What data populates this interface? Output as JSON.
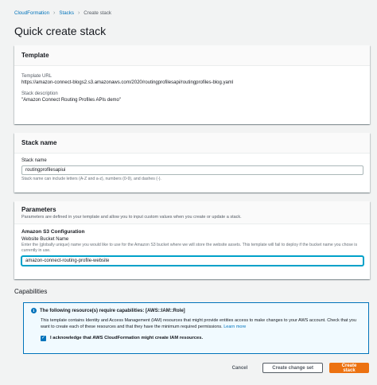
{
  "breadcrumb": {
    "items": [
      "CloudFormation",
      "Stacks",
      "Create stack"
    ]
  },
  "page_title": "Quick create stack",
  "template_panel": {
    "title": "Template",
    "url_label": "Template URL",
    "url_value": "https://amazon-connect-blogs2.s3.amazonaws.com/2020/routingprofilesapi/routingprofiles-blog.yaml",
    "desc_label": "Stack description",
    "desc_value": "Amazon Connect Routing Profiles APIs demo"
  },
  "stack_name_panel": {
    "title": "Stack name",
    "field_label": "Stack name",
    "field_value": "routingprofilesapiui",
    "hint": "Stack name can include letters (A-Z and a-z), numbers (0-9), and dashes (-)."
  },
  "parameters_panel": {
    "title": "Parameters",
    "description": "Parameters are defined in your template and allow you to input custom values when you create or update a stack.",
    "group_title": "Amazon S3 Configuration",
    "field_label": "Website Bucket Name",
    "field_hint": "Enter the (globally unique) name you would like to use for the Amazon S3 bucket where we will store the website assets. This template will fail to deploy if the bucket name you chose is currently in use.",
    "field_value": "amazon-connect-routing-profile-website"
  },
  "capabilities": {
    "title": "Capabilities",
    "alert_title": "The following resource(s) require capabilities: [AWS::IAM::Role]",
    "alert_text": "This template contains Identity and Access Management (IAM) resources that might provide entities access to make changes to your AWS account. Check that you want to create each of these resources and that they have the minimum required permissions.",
    "learn_more": "Learn more",
    "ack_label": "I acknowledge that AWS CloudFormation might create IAM resources.",
    "ack_checked": true
  },
  "footer": {
    "cancel": "Cancel",
    "change_set": "Create change set",
    "create": "Create stack"
  },
  "colors": {
    "link": "#0073bb",
    "primary": "#ec7211",
    "focus": "#00a1c9",
    "background": "#f2f3f3"
  }
}
